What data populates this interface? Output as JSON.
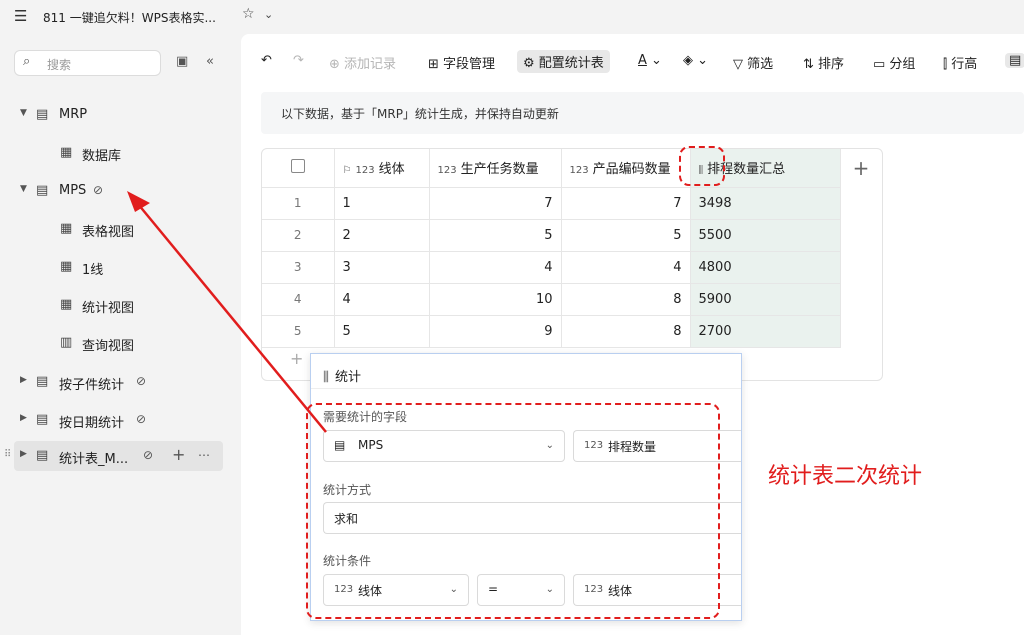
{
  "window": {
    "title": "811 一键追欠料！WPS表格实...",
    "menu_icon": "☰",
    "star_icon": "☆",
    "chevron_icon": "⌄"
  },
  "sidebar": {
    "search_placeholder": "搜索",
    "items": [
      {
        "label": "MRP",
        "expanded": true,
        "sync": false
      },
      {
        "label": "数据库"
      },
      {
        "label": "MPS",
        "expanded": true,
        "sync": true
      },
      {
        "label": "表格视图"
      },
      {
        "label": "1线"
      },
      {
        "label": "统计视图"
      },
      {
        "label": "查询视图"
      },
      {
        "label": "按子件统计",
        "sync": true
      },
      {
        "label": "按日期统计",
        "sync": true
      },
      {
        "label": "统计表_M...",
        "sync": true,
        "active": true
      }
    ]
  },
  "toolbar": {
    "add_record": "添加记录",
    "field_mgmt": "字段管理",
    "config_stats": "配置统计表",
    "filter": "筛选",
    "sort": "排序",
    "group": "分组",
    "row_height": "行高"
  },
  "banner": {
    "text": "以下数据，基于「MRP」统计生成，并保持自动更新"
  },
  "table": {
    "headers": [
      "线体",
      "生产任务数量",
      "产品编码数量",
      "排程数量汇总"
    ],
    "header_type": "123",
    "rows": [
      {
        "idx": "1",
        "line": "1",
        "tasks": "7",
        "codes": "7",
        "sum": "3498"
      },
      {
        "idx": "2",
        "line": "2",
        "tasks": "5",
        "codes": "5",
        "sum": "5500"
      },
      {
        "idx": "3",
        "line": "3",
        "tasks": "4",
        "codes": "4",
        "sum": "4800"
      },
      {
        "idx": "4",
        "line": "4",
        "tasks": "10",
        "codes": "8",
        "sum": "5900"
      },
      {
        "idx": "5",
        "line": "5",
        "tasks": "9",
        "codes": "8",
        "sum": "2700"
      }
    ]
  },
  "panel": {
    "title": "统计",
    "field_label": "需要统计的字段",
    "table_select": "MPS",
    "field_select": "排程数量",
    "method_label": "统计方式",
    "method_value": "求和",
    "cond_label": "统计条件",
    "cond_left": "线体",
    "cond_op": "=",
    "cond_right": "线体",
    "type_tag": "123"
  },
  "annotation": {
    "text": "统计表二次统计",
    "color": "#e11d1d"
  }
}
